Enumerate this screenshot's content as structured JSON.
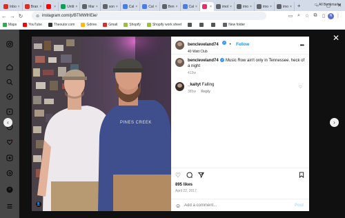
{
  "browser": {
    "tabs": [
      {
        "label": "Inbo",
        "color": "#d93025"
      },
      {
        "label": "Bran",
        "color": "#d93025"
      },
      {
        "label": "",
        "color": "#ff0000"
      },
      {
        "label": "Untit",
        "color": "#0f9d58"
      },
      {
        "label": "Mar",
        "color": "#5f6368"
      },
      {
        "label": "son",
        "color": "#5f6368"
      },
      {
        "label": "Cal",
        "color": "#4a7de0"
      },
      {
        "label": "Cal",
        "color": "#4a7de0"
      },
      {
        "label": "Ben",
        "color": "#5f6368"
      },
      {
        "label": "Cal",
        "color": "#4a7de0"
      },
      {
        "label": "",
        "color": "#e1306c",
        "active": true
      },
      {
        "label": "imol",
        "color": "#5f6368"
      },
      {
        "label": "imo",
        "color": "#5f6368"
      },
      {
        "label": "imo",
        "color": "#5f6368"
      },
      {
        "label": "imo",
        "color": "#5f6368"
      }
    ],
    "new_tab": "+",
    "url": "instagram.com/p/BTMWfrIEie/",
    "bookmarks": [
      {
        "label": "Maps",
        "color": "#34a853"
      },
      {
        "label": "YouTube",
        "color": "#ff0000"
      },
      {
        "label": "Theoutor.com",
        "color": "#333333"
      },
      {
        "label": "Gdrive",
        "color": "#fbbc04"
      },
      {
        "label": "Gmail",
        "color": "#d93025"
      },
      {
        "label": "Shopify",
        "color": "#95bf47"
      },
      {
        "label": "Shopify work sheet",
        "color": "#95bf47"
      },
      {
        "label": "",
        "color": "#555555"
      },
      {
        "label": "",
        "color": "#555555"
      },
      {
        "label": "",
        "color": "#555555"
      },
      {
        "label": "New folder",
        "color": "#5f6368"
      }
    ],
    "all_bookmarks": "All Bookmarks",
    "profile_initial": "N"
  },
  "post": {
    "username": "bencleveland74",
    "follow_label": "Follow",
    "location": "40 Watt Club",
    "caption": "Music Row ain't only in Tennessee. heck of a night",
    "caption_age": "413w",
    "comment": {
      "username": "_kaityt",
      "text": "Falling",
      "age": "385w",
      "reply_label": "Reply"
    },
    "likes": "895 likes",
    "date": "April 22, 2017",
    "comment_placeholder": "Add a comment...",
    "post_label": "Post"
  },
  "photo": {
    "shirt_text": "PINES CREEK"
  }
}
